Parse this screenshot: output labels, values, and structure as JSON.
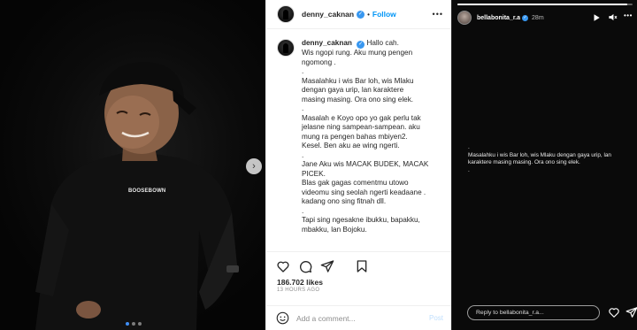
{
  "post": {
    "username": "denny_caknan",
    "separator": "•",
    "follow_label": "Follow",
    "more_label": "•••",
    "caption_lines": [
      "Wis ngopi rung. Aku mung pengen",
      "ngomong .",
      ".",
      "Masalahku i wis Bar loh, wis Mlaku",
      "dengan gaya urip, lan karaktere",
      "masing masing. Ora ono sing elek.",
      ".",
      "Masalah e Koyo opo yo gak perlu tak",
      "jelasne ning sampean-sampean. aku",
      "mung ra pengen bahas mbiyen2.",
      "Kesel. Ben aku ae wing ngerti.",
      ".",
      "Jane Aku wis MACAK BUDEK, MACAK",
      "PICEK.",
      "Blas gak gagas comentmu utowo",
      "videomu sing seolah ngerti keadaane .",
      "kadang ono sing fitnah dll.",
      ".",
      "Tapi sing ngesakne ibukku, bapakku,",
      "mbakku, lan Bojoku."
    ],
    "caption_first": "Hallo cah.",
    "likes": "186.702 likes",
    "time": "13 HOURS AGO",
    "comment_placeholder": "Add a comment...",
    "post_label": "Post"
  },
  "photo": {
    "shirt_text": "BOOSEBOWN",
    "next_icon": "chevron-right-icon",
    "dots": 3,
    "active_dot": 0
  },
  "story": {
    "username": "bellabonita_r.a",
    "time": "28m",
    "progress": 0.97,
    "text_lines": [
      ".",
      "Masalahku i wis Bar loh, wis Mlaku dengan gaya urip, lan",
      "karaktere masing masing. Ora ono sing elek.",
      "."
    ],
    "reply_placeholder": "Reply to bellabonita_r.a..."
  },
  "colors": {
    "accent": "#0095f6",
    "verified": "#3897f0",
    "story_bg": "#0a0a0a"
  }
}
